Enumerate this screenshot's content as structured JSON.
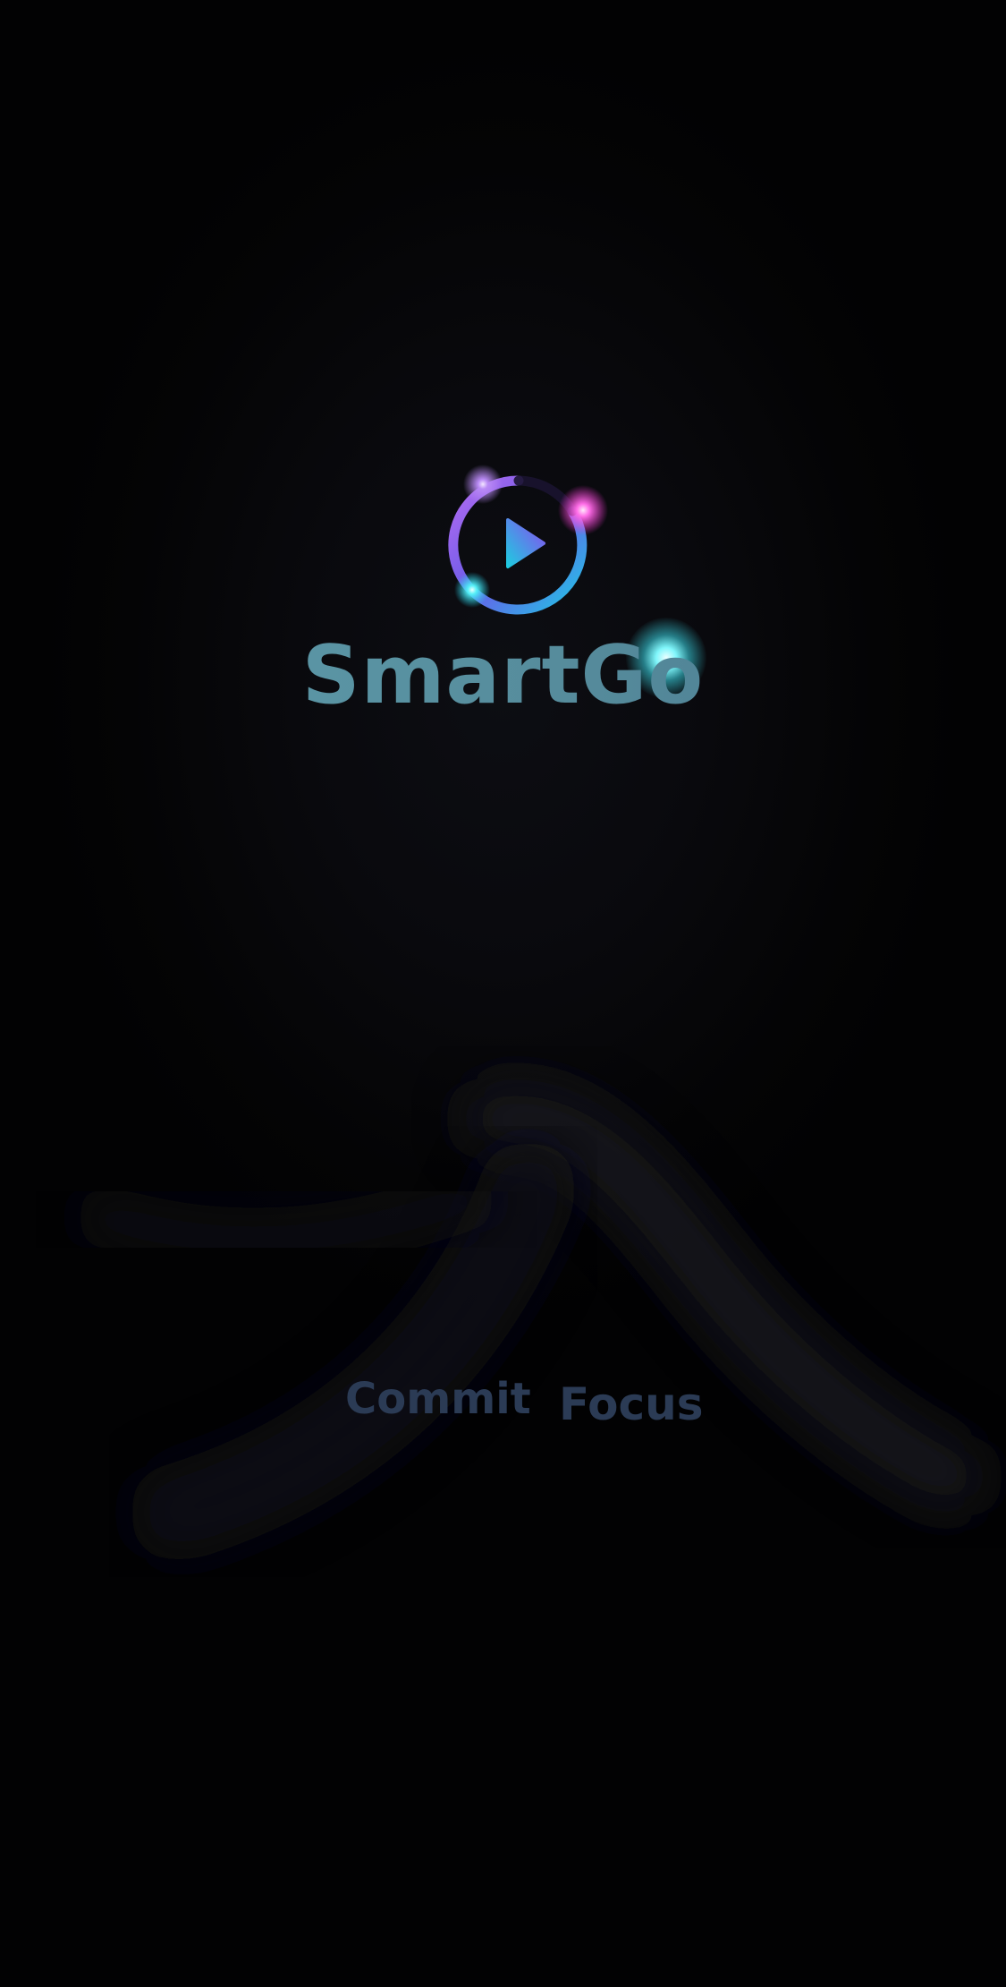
{
  "app": {
    "name": "SmartGo"
  },
  "logo": {
    "icon": "play-timer-icon",
    "ring_gradient": [
      "#b46cf0",
      "#6a5be8",
      "#1ec9e6"
    ],
    "play_gradient": [
      "#8a4cf0",
      "#1ecbe0"
    ],
    "glow_colors": {
      "violet": "#b98af5",
      "magenta": "#ff6ee8",
      "cyan": "#54f0f7"
    }
  },
  "tagline": {
    "word1": "Commit",
    "word2": "Focus"
  },
  "colors": {
    "background": "#020203",
    "brand_text": "#5f9fae",
    "tagline_text": "#2b3b55"
  }
}
